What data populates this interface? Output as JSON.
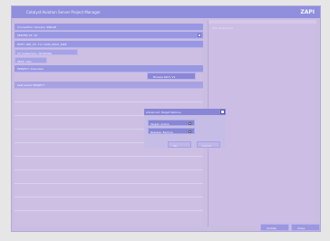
{
  "window": {
    "title": "Catalyst Aviation Server Project Manager",
    "logo": "ZAPI"
  },
  "form": {
    "connection_label": "Connection: Servers. SINGLE",
    "server_label": "SERVER 01: 10",
    "path_label": "PATH: APP_V2: 7.0: DATA_PACK_SIZE",
    "path_sub_1": "V2 Subsection: WORKING",
    "path_sub_2": "SECT: OLD",
    "project_label": "PROJECT: Overview",
    "browse_label": "Browse Path: V1",
    "info_label": "Last saved PROJECT"
  },
  "right_panel": {
    "label": "Item Properties"
  },
  "dialog": {
    "title": "Advanced: Target Options",
    "field_1": "Target: Active",
    "field_2": "Release: Backup",
    "ok_label": "OK",
    "cancel_label": "Cancel"
  },
  "footer": {
    "apply_label": "Update",
    "close_label": "Close"
  }
}
